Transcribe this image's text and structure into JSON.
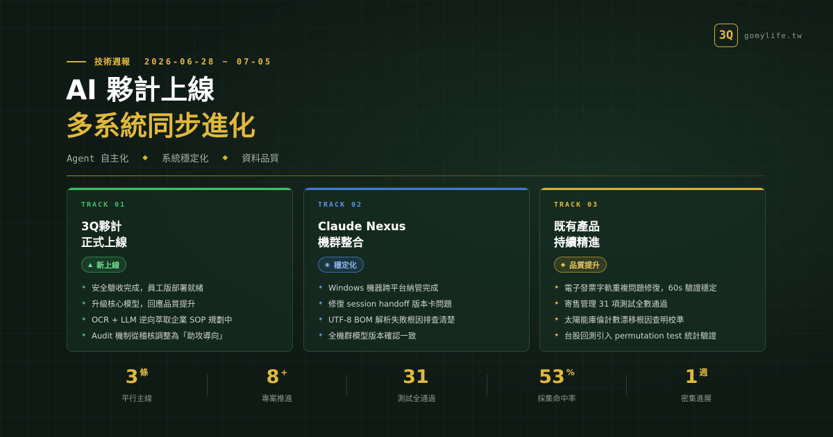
{
  "brand": {
    "badge": "3Q",
    "domain": "gomylife.tw"
  },
  "header": {
    "tag": "技術週報",
    "date_range": "2026-06-28 ~ 07-05",
    "title_line1": "AI 夥計上線",
    "title_line2": "多系統同步進化",
    "keywords": [
      "Agent 自主化",
      "系統穩定化",
      "資料品質"
    ],
    "keyword_separator_icon": "diamond-icon"
  },
  "colors": {
    "green": "#3fbf6a",
    "blue": "#3f78d8",
    "gold": "#d8b03a"
  },
  "tracks": [
    {
      "track": "TRACK 01",
      "title_line1": "3Q夥計",
      "title_line2": "正式上線",
      "badge_icon": "triangle-up-icon",
      "badge": "新上線",
      "items": [
        "安全驗收完成，員工版部署就緒",
        "升級核心模型，回應品質提升",
        "OCR + LLM 逆向萃取企業 SOP 規劃中",
        "Audit 機制從稽核調整為「助攻導向」"
      ]
    },
    {
      "track": "TRACK 02",
      "title_line1": "Claude Nexus",
      "title_line2": "機群整合",
      "badge_icon": "dot-icon",
      "badge": "穩定化",
      "items": [
        "Windows 機器跨平台納管完成",
        "修復 session handoff 版本卡問題",
        "UTF-8 BOM 解析失敗根因排查清楚",
        "全機群模型版本確認一致"
      ]
    },
    {
      "track": "TRACK 03",
      "title_line1": "既有產品",
      "title_line2": "持續精進",
      "badge_icon": "diamond-icon",
      "badge": "品質提升",
      "items": [
        "電子發票字軌重複問題修復，60s 驗證穩定",
        "寄售管理 31 項測試全數通過",
        "太陽能庫倫計數漂移根因查明校準",
        "台股回測引入 permutation test 統計驗證"
      ]
    }
  ],
  "stats": [
    {
      "value": "3",
      "unit": "條",
      "label": "平行主線"
    },
    {
      "value": "8",
      "unit": "+",
      "label": "專案推進"
    },
    {
      "value": "31",
      "unit": "",
      "label": "測試全通過"
    },
    {
      "value": "53",
      "unit": "%",
      "label": "採集命中率"
    },
    {
      "value": "1",
      "unit": "週",
      "label": "密集進展"
    }
  ]
}
